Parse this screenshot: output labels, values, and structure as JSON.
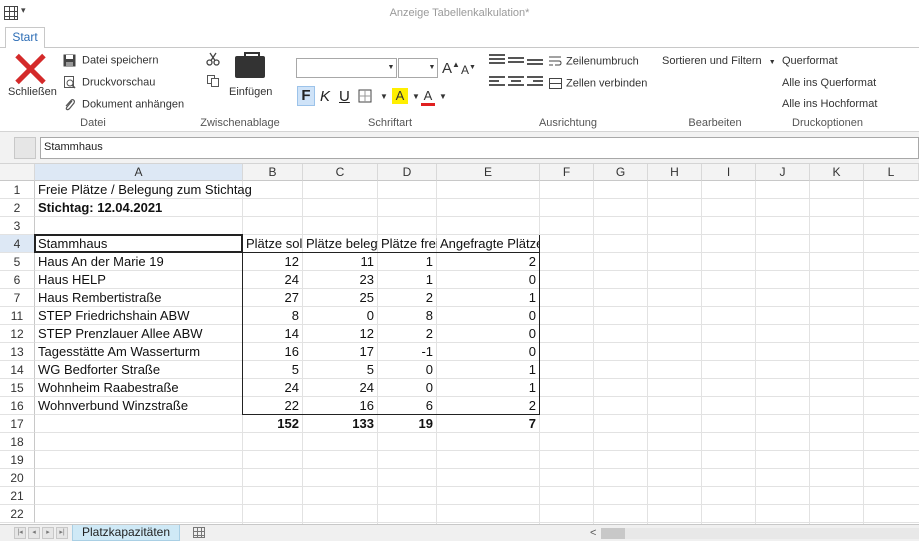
{
  "window": {
    "title": "Anzeige Tabellenkalkulation*"
  },
  "tabs": [
    {
      "label": "Start"
    }
  ],
  "ribbon": {
    "datei": {
      "label": "Datei",
      "close_label": "Schließen",
      "save_label": "Datei speichern",
      "preview_label": "Druckvorschau",
      "attach_label": "Dokument anhängen"
    },
    "clipboard": {
      "label": "Zwischenablage",
      "paste_label": "Einfügen"
    },
    "font": {
      "label": "Schriftart",
      "font_name": "",
      "font_size": "",
      "grow_label": "A",
      "shrink_label": "A",
      "bold_label": "F",
      "italic_label": "K",
      "underline_label": "U",
      "highlight_label": "A",
      "fontcolor_label": "A",
      "highlight_color": "#ffef00",
      "fontcolor_color": "#e02020"
    },
    "alignment": {
      "label": "Ausrichtung",
      "wrap_label": "Zeilenumbruch",
      "merge_label": "Zellen verbinden"
    },
    "edit": {
      "label": "Bearbeiten",
      "sort_label": "Sortieren und Filtern"
    },
    "print": {
      "label": "Druckoptionen",
      "landscape_label": "Querformat",
      "all_landscape_label": "Alle ins Querformat",
      "all_portrait_label": "Alle ins Hochformat"
    }
  },
  "formula_bar": {
    "value": "Stammhaus"
  },
  "sheet": {
    "columns": [
      "A",
      "B",
      "C",
      "D",
      "E",
      "F",
      "G",
      "H",
      "I",
      "J",
      "K",
      "L"
    ],
    "rows": [
      {
        "num": "1",
        "a": "Freie Plätze / Belegung zum Stichtag",
        "b": "",
        "c": "",
        "d": "",
        "e": ""
      },
      {
        "num": "2",
        "a": "Stichtag: 12.04.2021",
        "b": "",
        "c": "",
        "d": "",
        "e": ""
      },
      {
        "num": "3",
        "a": "",
        "b": "",
        "c": "",
        "d": "",
        "e": ""
      },
      {
        "num": "4",
        "a": "Stammhaus",
        "b": "Plätze soll",
        "c": "Plätze belegt",
        "d": "Plätze frei",
        "e": "Angefragte Plätze"
      },
      {
        "num": "5",
        "a": "Haus An der Marie 19",
        "b": "12",
        "c": "11",
        "d": "1",
        "e": "2"
      },
      {
        "num": "6",
        "a": "Haus HELP",
        "b": "24",
        "c": "23",
        "d": "1",
        "e": "0"
      },
      {
        "num": "7",
        "a": "Haus Rembertistraße",
        "b": "27",
        "c": "25",
        "d": "2",
        "e": "1"
      },
      {
        "num": "11",
        "a": "STEP Friedrichshain ABW",
        "b": "8",
        "c": "0",
        "d": "8",
        "e": "0"
      },
      {
        "num": "12",
        "a": "STEP Prenzlauer Allee ABW",
        "b": "14",
        "c": "12",
        "d": "2",
        "e": "0"
      },
      {
        "num": "13",
        "a": "Tagesstätte Am Wasserturm",
        "b": "16",
        "c": "17",
        "d": "-1",
        "e": "0"
      },
      {
        "num": "14",
        "a": "WG Bedforter Straße",
        "b": "5",
        "c": "5",
        "d": "0",
        "e": "1"
      },
      {
        "num": "15",
        "a": "Wohnheim Raabestraße",
        "b": "24",
        "c": "24",
        "d": "0",
        "e": "1"
      },
      {
        "num": "16",
        "a": "Wohnverbund Winzstraße",
        "b": "22",
        "c": "16",
        "d": "6",
        "e": "2"
      },
      {
        "num": "17",
        "a": "",
        "b": "152",
        "c": "133",
        "d": "19",
        "e": "7"
      },
      {
        "num": "18",
        "a": "",
        "b": "",
        "c": "",
        "d": "",
        "e": ""
      },
      {
        "num": "19",
        "a": "",
        "b": "",
        "c": "",
        "d": "",
        "e": ""
      },
      {
        "num": "20",
        "a": "",
        "b": "",
        "c": "",
        "d": "",
        "e": ""
      },
      {
        "num": "21",
        "a": "",
        "b": "",
        "c": "",
        "d": "",
        "e": ""
      },
      {
        "num": "22",
        "a": "",
        "b": "",
        "c": "",
        "d": "",
        "e": ""
      }
    ]
  },
  "bottom": {
    "sheet_tab": "Platzkapazitäten"
  }
}
